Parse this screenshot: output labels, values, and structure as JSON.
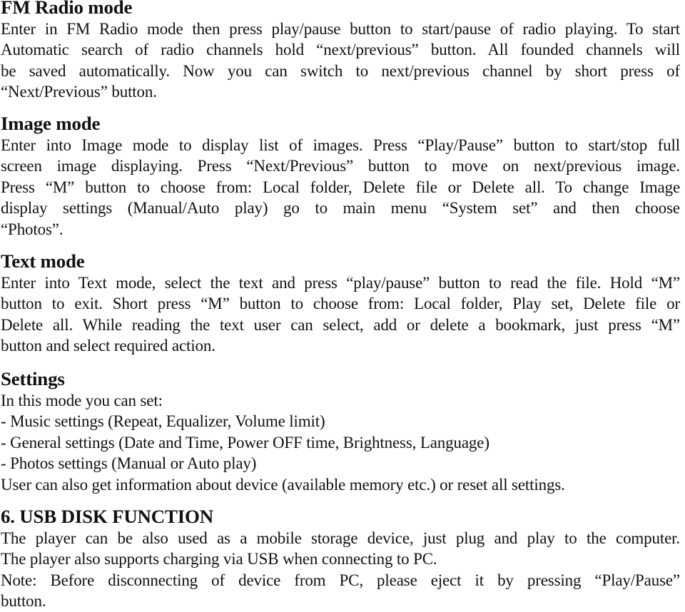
{
  "sections": {
    "fm_radio": {
      "heading": "FM Radio mode",
      "lines": [
        "Enter in FM Radio mode then press play/pause button to start/pause of radio playing. To start",
        "Automatic search of radio channels hold “next/previous” button. All founded channels will",
        "be saved automatically. Now you can switch to next/previous channel by short press of",
        "“Next/Previous” button."
      ]
    },
    "image_mode": {
      "heading": "Image mode",
      "lines": [
        "Enter into Image mode to display list of images. Press “Play/Pause” button to start/stop full",
        "screen image displaying. Press “Next/Previous” button to move on next/previous image.",
        "Press “M” button to choose from: Local folder, Delete file or Delete all. To change Image",
        "display settings (Manual/Auto play) go to main menu “System set” and then choose",
        "“Photos”."
      ]
    },
    "text_mode": {
      "heading": "Text mode",
      "lines": [
        "Enter into Text mode, select the text and press “play/pause” button to read the file. Hold “M”",
        "button to exit. Short press “M” button to choose from: Local folder, Play set, Delete file or",
        "Delete all. While reading the text user can select, add or delete a bookmark, just press “M”",
        "button and select required action."
      ]
    },
    "settings": {
      "heading": "Settings",
      "intro": "In this mode you can set:",
      "items": [
        "- Music settings (Repeat, Equalizer, Volume limit)",
        "- General settings (Date and Time, Power OFF time, Brightness, Language)",
        "- Photos settings (Manual or Auto play)"
      ],
      "outro": "User can also get information about device (available memory etc.) or reset all settings."
    },
    "usb_disk": {
      "heading": "6. USB DISK FUNCTION",
      "lines": [
        "The player can be also used as a mobile storage device, just plug and play to the computer.",
        "The player also supports charging via USB when connecting to PC.",
        "Note: Before disconnecting of device from PC, please eject it by pressing “Play/Pause”",
        "button."
      ]
    }
  }
}
